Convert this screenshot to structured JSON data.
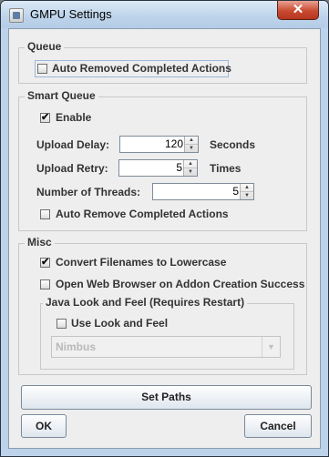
{
  "window": {
    "title": "GMPU Settings",
    "close_glyph": "✕"
  },
  "queue": {
    "legend": "Queue",
    "auto_remove_label": "Auto Removed Completed Actions",
    "auto_remove_checked": false
  },
  "smart_queue": {
    "legend": "Smart Queue",
    "enable_label": "Enable",
    "enable_checked": true,
    "upload_delay_label": "Upload Delay:",
    "upload_delay_value": "120",
    "upload_delay_unit": "Seconds",
    "upload_retry_label": "Upload Retry:",
    "upload_retry_value": "5",
    "upload_retry_unit": "Times",
    "threads_label": "Number of Threads:",
    "threads_value": "5",
    "auto_remove_label": "Auto Remove Completed Actions",
    "auto_remove_checked": false
  },
  "misc": {
    "legend": "Misc",
    "convert_label": "Convert Filenames to Lowercase",
    "convert_checked": true,
    "open_browser_label": "Open Web Browser on Addon Creation Success",
    "open_browser_checked": false,
    "laf": {
      "legend": "Java Look and Feel (Requires Restart)",
      "use_label": "Use Look and Feel",
      "use_checked": false,
      "selected": "Nimbus"
    }
  },
  "buttons": {
    "set_paths": "Set Paths",
    "ok": "OK",
    "cancel": "Cancel"
  },
  "glyphs": {
    "check": "✔",
    "up": "▲",
    "down": "▼"
  }
}
